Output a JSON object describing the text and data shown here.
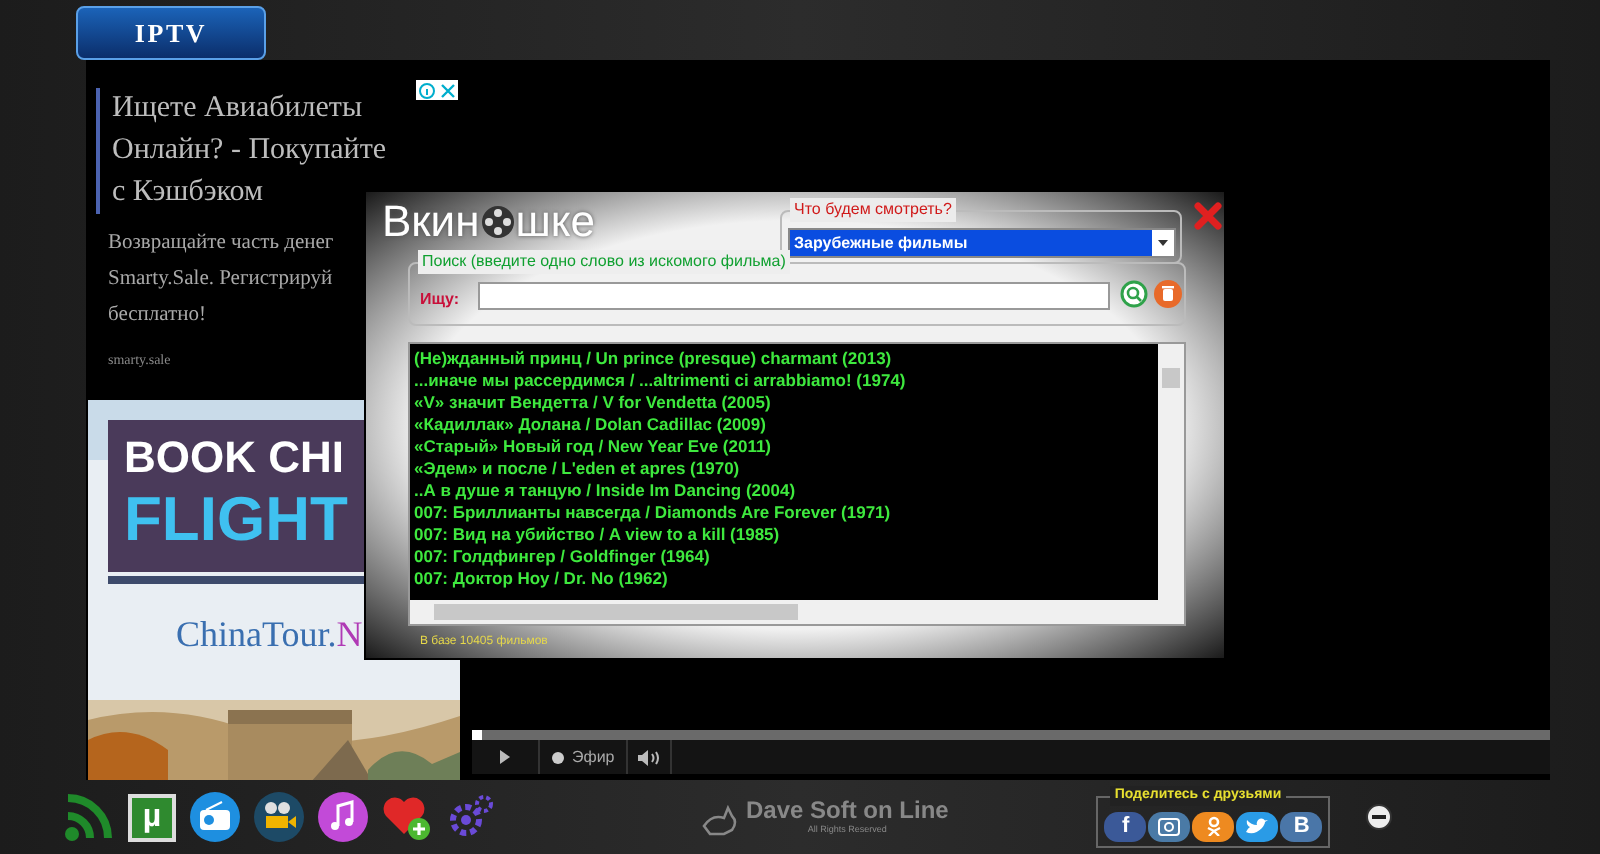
{
  "logo": {
    "text": "IPTV"
  },
  "ad": {
    "title": "Ищете Авиабилеты Онлайн? - Покупайте с Кэшбэком",
    "body_lines": [
      "Возвращайте часть денег",
      "Smarty.Sale. Регистрируй",
      "бесплатно!"
    ],
    "domain": "smarty.sale",
    "banner": {
      "line_1": "BOOK CHI",
      "line_2": "FLIGHT",
      "site": "ChinaTour.",
      "site_tail": "N"
    }
  },
  "dialog": {
    "logo_left": "Вкин",
    "logo_right": "шке",
    "category": {
      "legend": "Что будем смотреть?",
      "value": "Зарубежные фильмы"
    },
    "search": {
      "legend": "Поиск (введите одно слово из искомого фильма)",
      "label": "Ищу:"
    },
    "films": [
      "(Не)жданный принц / Un prince (presque) charmant (2013)",
      "...иначе мы рассердимся / ...altrimenti ci arrabbiamo! (1974)",
      "«V» значит Вендетта / V for Vendetta (2005)",
      "«Кадиллак» Долана / Dolan Cadillac (2009)",
      "«Старый» Новый год / New Year Eve (2011)",
      "«Эдем» и после / L'eden et apres (1970)",
      "..А в душе я танцую / Inside Im Dancing (2004)",
      "007: Бриллианты навсегда / Diamonds Are Forever (1971)",
      "007: Вид на убийство / A view to a kill (1985)",
      "007: Голдфингер / Goldfinger (1964)",
      "007: Доктор Ноу / Dr. No (1962)"
    ],
    "status": "В базе 10405 фильмов"
  },
  "player": {
    "level": 0.01,
    "live_label": "Эфир"
  },
  "toolbar": [
    {
      "kind": "signal"
    },
    {
      "kind": "torrent",
      "glyph": "µ"
    },
    {
      "kind": "radio"
    },
    {
      "kind": "projector"
    },
    {
      "kind": "music"
    },
    {
      "kind": "favorite"
    },
    {
      "kind": "settings"
    }
  ],
  "brand": {
    "name": "Dave Soft on Line",
    "rights": "All Rights Reserved"
  },
  "share": {
    "title": "Поделитесь с друзьями",
    "buttons": [
      {
        "kind": "facebook",
        "glyph": "f"
      },
      {
        "kind": "instagram"
      },
      {
        "kind": "odnoklassniki"
      },
      {
        "kind": "twitter"
      },
      {
        "kind": "vk",
        "glyph": "B"
      }
    ]
  }
}
